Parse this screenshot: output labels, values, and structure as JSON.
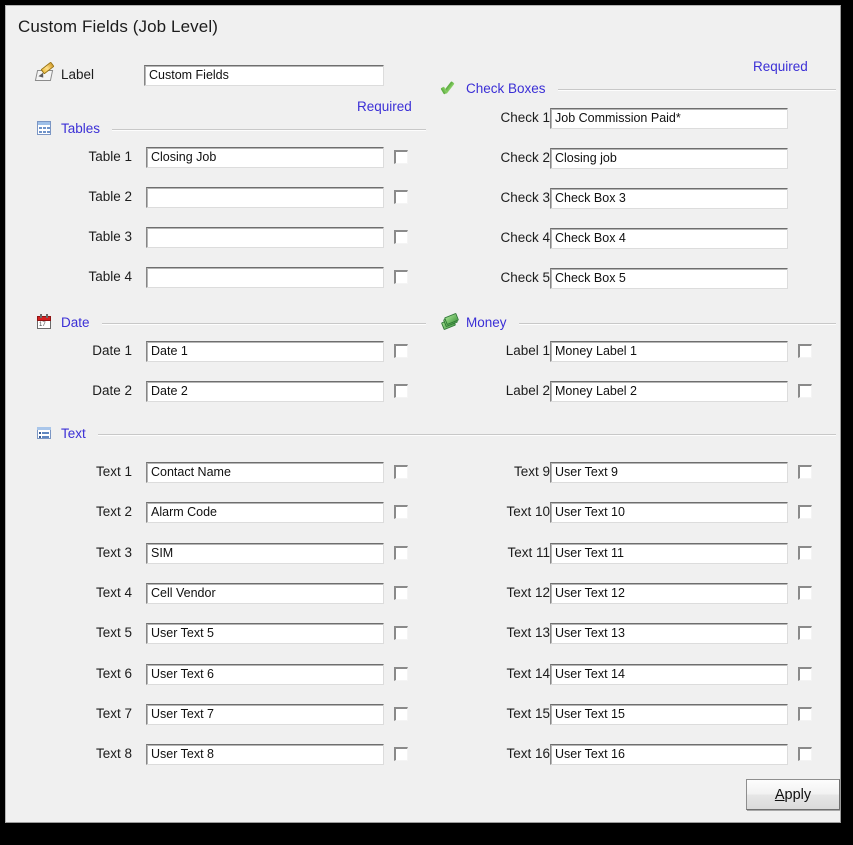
{
  "window": {
    "title": "Custom Fields (Job Level)",
    "background_color": "#f0f0f0",
    "accent_color": "#3b2fd6"
  },
  "required_labels": {
    "top_right": "Required",
    "top_left": "Required"
  },
  "label_section": {
    "icon": "label-pencil-icon",
    "heading": "Label",
    "field": {
      "row_label": "Label",
      "value": "Custom Fields"
    }
  },
  "tables_section": {
    "icon": "table-grid-icon",
    "heading": "Tables",
    "rows": [
      {
        "label": "Table 1",
        "value": "Closing Job",
        "checked": false
      },
      {
        "label": "Table 2",
        "value": "",
        "checked": false
      },
      {
        "label": "Table 3",
        "value": "",
        "checked": false
      },
      {
        "label": "Table 4",
        "value": "",
        "checked": false
      }
    ]
  },
  "checkboxes_section": {
    "icon": "green-check-icon",
    "heading": "Check Boxes",
    "rows": [
      {
        "label": "Check 1",
        "value": "Job Commission Paid*"
      },
      {
        "label": "Check 2",
        "value": "Closing job"
      },
      {
        "label": "Check 3",
        "value": "Check Box 3"
      },
      {
        "label": "Check 4",
        "value": "Check Box 4"
      },
      {
        "label": "Check 5",
        "value": "Check Box 5"
      }
    ]
  },
  "date_section": {
    "icon": "calendar-icon",
    "heading": "Date",
    "rows": [
      {
        "label": "Date 1",
        "value": "Date 1",
        "checked": false
      },
      {
        "label": "Date 2",
        "value": "Date 2",
        "checked": false
      }
    ]
  },
  "money_section": {
    "icon": "money-icon",
    "heading": "Money",
    "rows": [
      {
        "label": "Label 1",
        "value": "Money Label 1",
        "checked": false
      },
      {
        "label": "Label 2",
        "value": "Money Label 2",
        "checked": false
      }
    ]
  },
  "text_section": {
    "icon": "text-list-icon",
    "heading": "Text",
    "left_rows": [
      {
        "label": "Text 1",
        "value": "Contact Name",
        "checked": false
      },
      {
        "label": "Text 2",
        "value": "Alarm Code",
        "checked": false
      },
      {
        "label": "Text 3",
        "value": "SIM",
        "checked": false
      },
      {
        "label": "Text 4",
        "value": "Cell Vendor",
        "checked": false
      },
      {
        "label": "Text 5",
        "value": "User Text 5",
        "checked": false
      },
      {
        "label": "Text 6",
        "value": "User Text 6",
        "checked": false
      },
      {
        "label": "Text 7",
        "value": "User Text 7",
        "checked": false
      },
      {
        "label": "Text 8",
        "value": "User Text 8",
        "checked": false
      }
    ],
    "right_rows": [
      {
        "label": "Text 9",
        "value": "User Text 9",
        "checked": false
      },
      {
        "label": "Text 10",
        "value": "User Text 10",
        "checked": false
      },
      {
        "label": "Text 11",
        "value": "User Text 11",
        "checked": false
      },
      {
        "label": "Text 12",
        "value": "User Text 12",
        "checked": false
      },
      {
        "label": "Text 13",
        "value": "User Text 13",
        "checked": false
      },
      {
        "label": "Text 14",
        "value": "User Text 14",
        "checked": false
      },
      {
        "label": "Text 15",
        "value": "User Text 15",
        "checked": false
      },
      {
        "label": "Text 16",
        "value": "User Text 16",
        "checked": false
      }
    ]
  },
  "footer": {
    "apply_button": {
      "accel": "A",
      "rest": "pply"
    }
  }
}
